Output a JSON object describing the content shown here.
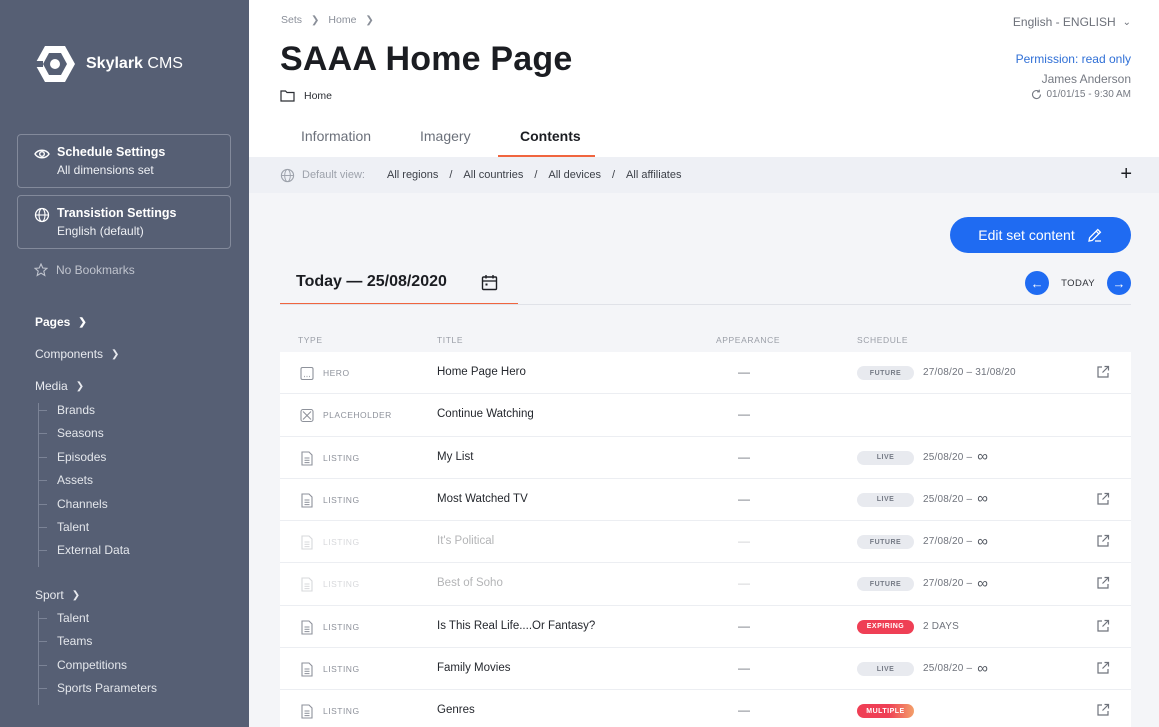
{
  "app": {
    "logo_bold": "Skylark",
    "logo_light": "CMS"
  },
  "sidebar": {
    "schedule": {
      "title": "Schedule Settings",
      "subtitle": "All dimensions set"
    },
    "transition": {
      "title": "Transistion Settings",
      "subtitle": "English (default)"
    },
    "bookmarks": "No Bookmarks",
    "pages": "Pages",
    "components": "Components",
    "media": {
      "label": "Media",
      "items": [
        "Brands",
        "Seasons",
        "Episodes",
        "Assets",
        "Channels",
        "Talent",
        "External Data"
      ]
    },
    "sport": {
      "label": "Sport",
      "items": [
        "Talent",
        "Teams",
        "Competitions",
        "Sports Parameters"
      ]
    }
  },
  "header": {
    "breadcrumb": [
      "Sets",
      "Home"
    ],
    "language": "English - ENGLISH",
    "title": "SAAA Home Page",
    "folder": "Home",
    "permission": "Permission: read only",
    "user": "James Anderson",
    "updated": "01/01/15 - 9:30 AM"
  },
  "tabs": [
    "Information",
    "Imagery",
    "Contents"
  ],
  "view_bar": {
    "label": "Default view:",
    "regions": "All regions",
    "countries": "All countries",
    "devices": "All devices",
    "affiliates": "All affiliates",
    "slash": "/",
    "plus": "+"
  },
  "toolbar": {
    "edit": "Edit set content"
  },
  "date_nav": {
    "date": "Today — 25/08/2020",
    "today": "TODAY",
    "prev": "←",
    "next": "→"
  },
  "columns": {
    "type": "TYPE",
    "title": "TITLE",
    "appearance": "APPEARANCE",
    "schedule": "SCHEDULE"
  },
  "rows": [
    {
      "type": "HERO",
      "title": "Home Page Hero",
      "appearance": "—",
      "badge": "FUTURE",
      "schedule": "27/08/20 – 31/08/20",
      "infinity": ""
    },
    {
      "type": "PLACEHOLDER",
      "title": "Continue Watching",
      "appearance": "—",
      "badge": "",
      "schedule": "",
      "infinity": ""
    },
    {
      "type": "LISTING",
      "title": "My List",
      "appearance": "—",
      "badge": "LIVE",
      "schedule": "25/08/20 –",
      "infinity": "∞"
    },
    {
      "type": "LISTING",
      "title": "Most Watched TV",
      "appearance": "—",
      "badge": "LIVE",
      "schedule": "25/08/20 –",
      "infinity": "∞"
    },
    {
      "type": "LISTING",
      "title": "It's Political",
      "appearance": "—",
      "badge": "FUTURE",
      "schedule": "27/08/20 –",
      "infinity": "∞"
    },
    {
      "type": "LISTING",
      "title": "Best of Soho",
      "appearance": "—",
      "badge": "FUTURE",
      "schedule": "27/08/20 –",
      "infinity": "∞"
    },
    {
      "type": "LISTING",
      "title": "Is This Real Life....Or Fantasy?",
      "appearance": "—",
      "badge": "EXPIRING",
      "schedule": "2 DAYS",
      "infinity": ""
    },
    {
      "type": "LISTING",
      "title": "Family Movies",
      "appearance": "—",
      "badge": "LIVE",
      "schedule": "25/08/20 –",
      "infinity": "∞"
    },
    {
      "type": "LISTING",
      "title": "Genres",
      "appearance": "—",
      "badge": "MULTIPLE",
      "schedule": "",
      "infinity": ""
    }
  ],
  "colors": {
    "sidebar": "#565f74",
    "accent": "#1f6bf2",
    "tab_underline": "#f0653f",
    "expiring": "#ef3f55"
  }
}
